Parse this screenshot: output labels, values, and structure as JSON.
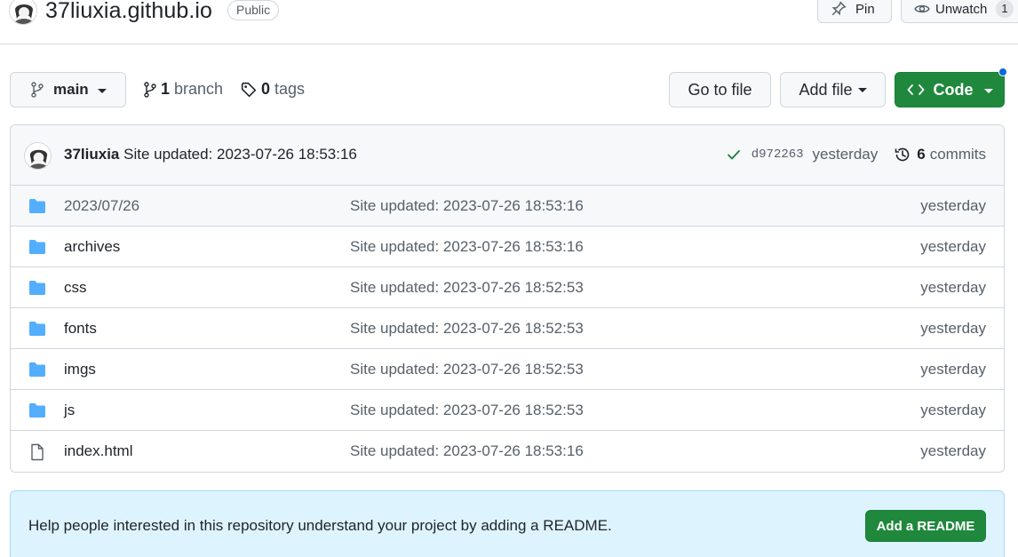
{
  "header": {
    "repo_name": "37liuxia.github.io",
    "visibility": "Public",
    "pin_label": "Pin",
    "unwatch_label": "Unwatch",
    "watch_count": "1"
  },
  "toolbar": {
    "branch_name": "main",
    "branch_count": "1",
    "branch_label": "branch",
    "tag_count": "0",
    "tag_label": "tags",
    "goto_file_label": "Go to file",
    "add_file_label": "Add file",
    "code_label": "Code"
  },
  "latest_commit": {
    "author": "37liuxia",
    "message": "Site updated: 2023-07-26 18:53:16",
    "sha": "d972263",
    "time": "yesterday",
    "commit_count": "6",
    "commits_label": "commits"
  },
  "files": [
    {
      "name": "2023/07/26",
      "type": "folder",
      "message": "Site updated: 2023-07-26 18:53:16",
      "time": "yesterday"
    },
    {
      "name": "archives",
      "type": "folder",
      "message": "Site updated: 2023-07-26 18:53:16",
      "time": "yesterday"
    },
    {
      "name": "css",
      "type": "folder",
      "message": "Site updated: 2023-07-26 18:52:53",
      "time": "yesterday"
    },
    {
      "name": "fonts",
      "type": "folder",
      "message": "Site updated: 2023-07-26 18:52:53",
      "time": "yesterday"
    },
    {
      "name": "imgs",
      "type": "folder",
      "message": "Site updated: 2023-07-26 18:52:53",
      "time": "yesterday"
    },
    {
      "name": "js",
      "type": "folder",
      "message": "Site updated: 2023-07-26 18:52:53",
      "time": "yesterday"
    },
    {
      "name": "index.html",
      "type": "file",
      "message": "Site updated: 2023-07-26 18:53:16",
      "time": "yesterday"
    }
  ],
  "readme_banner": {
    "text": "Help people interested in this repository understand your project by adding a README.",
    "button_label": "Add a README"
  },
  "colors": {
    "primary_green": "#1f883d",
    "folder_blue": "#54aeff",
    "banner_bg": "#ddf4ff",
    "link_muted": "#57606a",
    "notification_dot": "#0969da"
  },
  "icons": {
    "folder": "folder-icon",
    "file": "file-icon",
    "branch": "git-branch-icon",
    "tag": "tag-icon",
    "history": "history-icon",
    "check": "check-icon",
    "pin": "pin-icon",
    "eye": "eye-icon",
    "code": "code-icon"
  }
}
